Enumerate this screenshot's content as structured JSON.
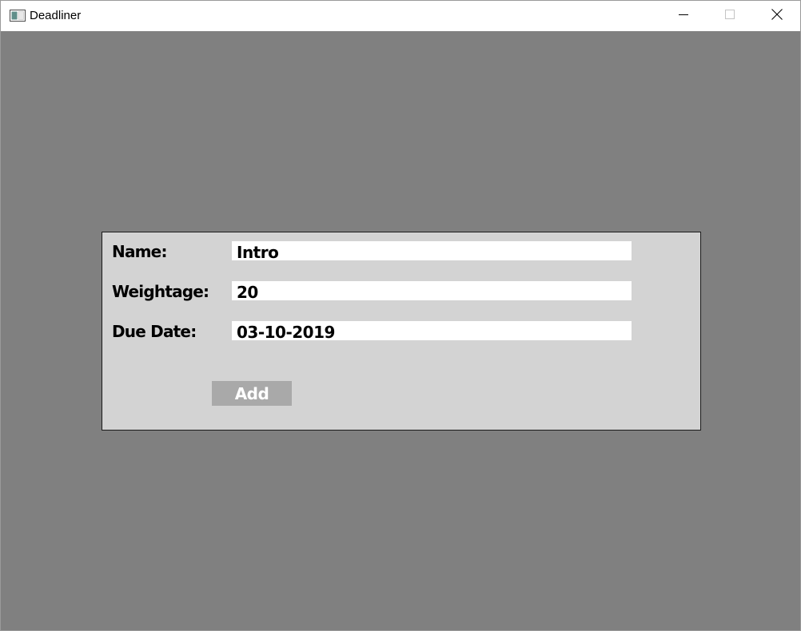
{
  "window": {
    "title": "Deadliner",
    "icons": {
      "app": "app-window-icon",
      "minimize": "minimize-icon",
      "maximize": "maximize-icon",
      "close": "close-icon"
    }
  },
  "form": {
    "name_label": "Name:",
    "name_value": "Intro",
    "weightage_label": "Weightage:",
    "weightage_value": "20",
    "due_date_label": "Due Date:",
    "due_date_value": "03-10-2019",
    "add_label": "Add"
  },
  "colors": {
    "background": "#808080",
    "panel": "#d3d3d3",
    "field": "#ffffff",
    "button": "#a9a9a9",
    "button_text": "#ffffff"
  }
}
